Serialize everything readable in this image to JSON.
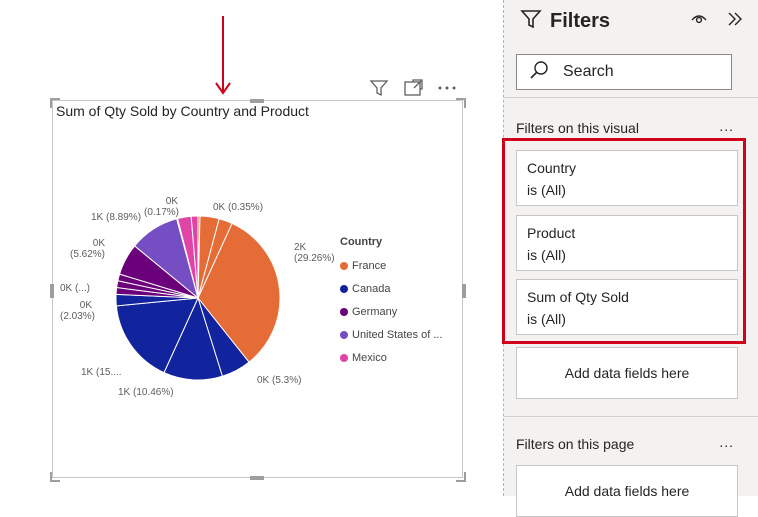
{
  "visual": {
    "title": "Sum of Qty Sold by Country and Product",
    "toolbar": {
      "filter_icon": "filter-icon",
      "focus_icon": "focus-mode-icon",
      "more_icon": "more-options-icon"
    }
  },
  "chart_data": {
    "type": "pie",
    "legend_title": "Country",
    "legend_position": "right",
    "legend": [
      {
        "name": "France",
        "color": "#e66c37"
      },
      {
        "name": "Canada",
        "color": "#12239e"
      },
      {
        "name": "Germany",
        "color": "#6b007b"
      },
      {
        "name": "United States of ...",
        "color": "#744ec2"
      },
      {
        "name": "Mexico",
        "color": "#e044a7"
      }
    ],
    "slices": [
      {
        "country": "France",
        "value": 0.0035,
        "color": "#e66c37"
      },
      {
        "country": "France",
        "value": 0.034,
        "color": "#e66c37"
      },
      {
        "country": "France",
        "value": 0.024,
        "color": "#e66c37"
      },
      {
        "country": "France",
        "value": 0.2926,
        "color": "#e66c37"
      },
      {
        "country": "Canada",
        "value": 0.053,
        "color": "#12239e"
      },
      {
        "country": "Canada",
        "value": 0.1046,
        "color": "#12239e"
      },
      {
        "country": "Canada",
        "value": 0.15,
        "color": "#12239e"
      },
      {
        "country": "Canada",
        "value": 0.0203,
        "color": "#12239e"
      },
      {
        "country": "Germany",
        "value": 0.012,
        "color": "#6b007b"
      },
      {
        "country": "Germany",
        "value": 0.012,
        "color": "#6b007b"
      },
      {
        "country": "Germany",
        "value": 0.012,
        "color": "#6b007b"
      },
      {
        "country": "Germany",
        "value": 0.0562,
        "color": "#6b007b"
      },
      {
        "country": "United States of ...",
        "value": 0.0889,
        "color": "#744ec2"
      },
      {
        "country": "Mexico",
        "value": 0.0017,
        "color": "#e044a7"
      },
      {
        "country": "Mexico",
        "value": 0.024,
        "color": "#e044a7"
      },
      {
        "country": "Mexico",
        "value": 0.012,
        "color": "#e044a7"
      }
    ],
    "data_labels": [
      "0K (0.35%)",
      "2K\n(29.26%)",
      "0K (5.3%)",
      "1K (10.46%)",
      "1K (15....",
      "0K\n(2.03%)",
      "0K (...)",
      "0K\n(5.62%)",
      "1K (8.89%)",
      "0K\n(0.17%)"
    ]
  },
  "filters_pane": {
    "title": "Filters",
    "search_placeholder": "Search",
    "section_visual": "Filters on this visual",
    "section_page": "Filters on this page",
    "more": "...",
    "cards": [
      {
        "field": "Country",
        "state": "is (All)"
      },
      {
        "field": "Product",
        "state": "is (All)"
      },
      {
        "field": "Sum of Qty Sold",
        "state": "is (All)"
      }
    ],
    "add_fields": "Add data fields here"
  }
}
